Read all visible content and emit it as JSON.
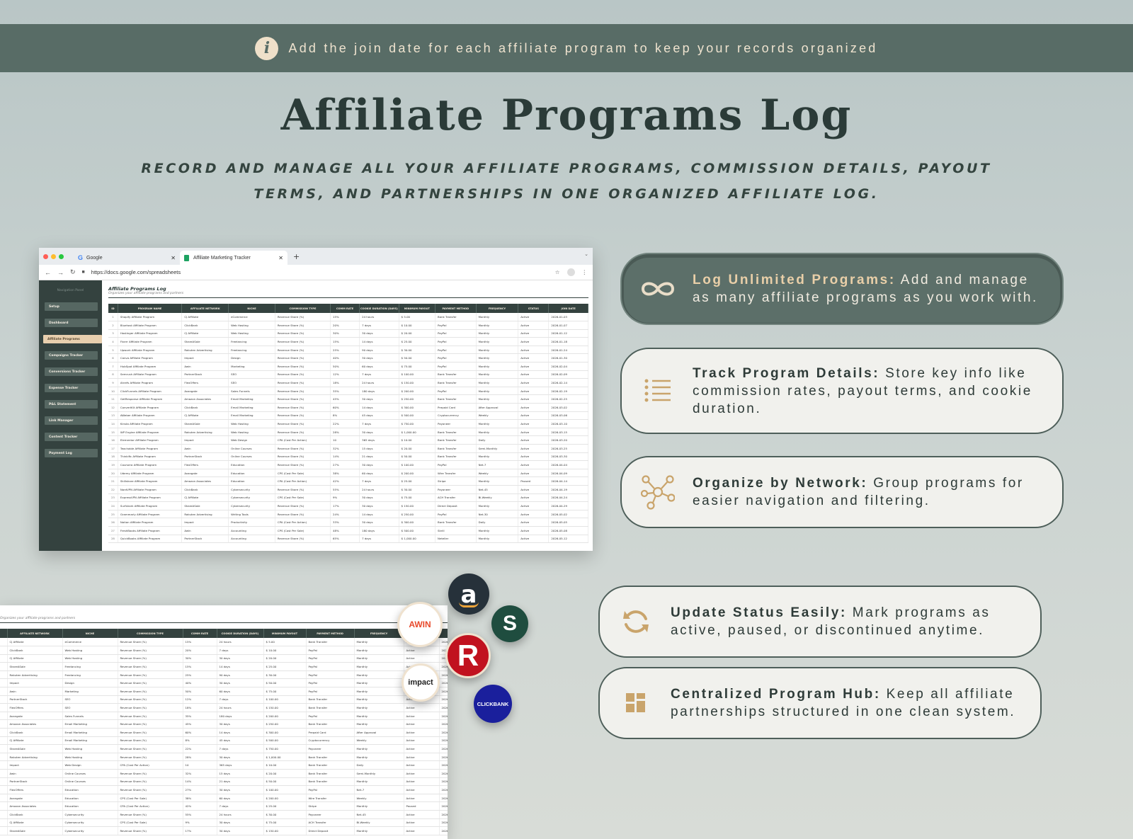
{
  "banner": {
    "icon": "info-icon",
    "text": "Add the join date for each affiliate program to keep your records organized"
  },
  "title": "Affiliate Programs Log",
  "subtitle": "RECORD AND MANAGE ALL YOUR AFFILIATE PROGRAMS, COMMISSION DETAILS, PAYOUT TERMS, AND PARTNERSHIPS IN ONE ORGANIZED AFFILIATE LOG.",
  "browser": {
    "tabs": [
      {
        "label": "Google",
        "icon": "google-icon"
      },
      {
        "label": "Affiliate Marketing Tracker",
        "icon": "sheets-icon"
      }
    ],
    "url": "https://docs.google.com/spreadsheets"
  },
  "sidebar": {
    "title": "Navigation Panel",
    "items": [
      {
        "label": "Setup"
      },
      {
        "label": "Dashboard"
      },
      {
        "label": "Affiliate Programs"
      },
      {
        "label": "Campaigns Tracker"
      },
      {
        "label": "Conversions Tracker"
      },
      {
        "label": "Expense Tracker"
      },
      {
        "label": "P&L Statement"
      },
      {
        "label": "Link Manager"
      },
      {
        "label": "Content Tracker"
      },
      {
        "label": "Payment Log"
      }
    ],
    "active": "Affiliate Programs"
  },
  "sheet": {
    "title": "Affiliate Programs Log",
    "subtitle": "Organizes your affiliate programs and partners",
    "columns": [
      "ID",
      "Program Name",
      "Affiliate Network",
      "Niche",
      "Commission Type",
      "Comm Rate",
      "Cookie Duration (Days)",
      "Minimum Payout",
      "Payment Method",
      "Frequency",
      "Status",
      "Join Date"
    ],
    "rows": [
      [
        "1",
        "Shopify Affiliate Program",
        "CJ Affiliate",
        "eCommerce",
        "Revenue Share (%)",
        "15%",
        "24 hours",
        "$ 5.00",
        "Bank Transfer",
        "Monthly",
        "Active",
        "2026-01-03"
      ],
      [
        "2",
        "Bluehost Affiliate Program",
        "ClickBank",
        "Web Hosting",
        "Revenue Share (%)",
        "20%",
        "7 days",
        "$ 10.00",
        "PayPal",
        "Monthly",
        "Active",
        "2026-01-07"
      ],
      [
        "3",
        "Hostinger Affiliate Program",
        "CJ Affiliate",
        "Web Hosting",
        "Revenue Share (%)",
        "30%",
        "30 days",
        "$ 20.00",
        "PayPal",
        "Monthly",
        "Active",
        "2026-01-12"
      ],
      [
        "4",
        "Fiverr Affiliate Program",
        "ShareASale",
        "Freelancing",
        "Revenue Share (%)",
        "15%",
        "14 days",
        "$ 25.00",
        "PayPal",
        "Monthly",
        "Active",
        "2026-01-18"
      ],
      [
        "5",
        "Upwork Affiliate Program",
        "Rakuten Advertising",
        "Freelancing",
        "Revenue Share (%)",
        "25%",
        "90 days",
        "$ 30.00",
        "PayPal",
        "Monthly",
        "Active",
        "2026-01-24"
      ],
      [
        "6",
        "Canva Affiliate Program",
        "Impact",
        "Design",
        "Revenue Share (%)",
        "40%",
        "30 days",
        "$ 50.00",
        "PayPal",
        "Monthly",
        "Active",
        "2026-01-30"
      ],
      [
        "7",
        "HubSpot Affiliate Program",
        "Awin",
        "Marketing",
        "Revenue Share (%)",
        "50%",
        "60 days",
        "$ 75.00",
        "PayPal",
        "Monthly",
        "Active",
        "2026-02-04"
      ],
      [
        "8",
        "Semrush Affiliate Program",
        "PartnerStack",
        "SEO",
        "Revenue Share (%)",
        "12%",
        "7 days",
        "$ 100.00",
        "Bank Transfer",
        "Monthly",
        "Active",
        "2026-02-09"
      ],
      [
        "9",
        "Ahrefs Affiliate Program",
        "FlexOffers",
        "SEO",
        "Revenue Share (%)",
        "18%",
        "24 hours",
        "$ 150.00",
        "Bank Transfer",
        "Monthly",
        "Active",
        "2026-02-14"
      ],
      [
        "10",
        "ClickFunnels Affiliate Program",
        "Avangate",
        "Sales Funnels",
        "Revenue Share (%)",
        "35%",
        "180 days",
        "$ 200.00",
        "PayPal",
        "Monthly",
        "Active",
        "2026-02-19"
      ],
      [
        "11",
        "GetResponse Affiliate Program",
        "Amazon Associates",
        "Email Marketing",
        "Revenue Share (%)",
        "45%",
        "30 days",
        "$ 250.00",
        "Bank Transfer",
        "Monthly",
        "Active",
        "2026-02-25"
      ],
      [
        "12",
        "ConvertKit Affiliate Program",
        "ClickBank",
        "Email Marketing",
        "Revenue Share (%)",
        "60%",
        "14 days",
        "$ 300.00",
        "Prepaid Card",
        "After Approval",
        "Active",
        "2026-03-02"
      ],
      [
        "13",
        "AWeber Affiliate Program",
        "CJ Affiliate",
        "Email Marketing",
        "Revenue Share (%)",
        "8%",
        "45 days",
        "$ 500.00",
        "Cryptocurrency",
        "Weekly",
        "Active",
        "2026-03-06"
      ],
      [
        "14",
        "Kinsta Affiliate Program",
        "ShareASale",
        "Web Hosting",
        "Revenue Share (%)",
        "22%",
        "7 days",
        "$ 750.00",
        "Payoneer",
        "Monthly",
        "Active",
        "2026-03-10"
      ],
      [
        "15",
        "WP Engine Affiliate Program",
        "Rakuten Advertising",
        "Web Hosting",
        "Revenue Share (%)",
        "28%",
        "30 days",
        "$ 1,000.00",
        "Bank Transfer",
        "Monthly",
        "Active",
        "2026-03-15"
      ],
      [
        "16",
        "Elementor Affiliate Program",
        "Impact",
        "Web Design",
        "CPA (Cost Per Action)",
        "10",
        "365 days",
        "$ 10.00",
        "Bank Transfer",
        "Daily",
        "Active",
        "2026-03-20"
      ],
      [
        "17",
        "Teachable Affiliate Program",
        "Awin",
        "Online Courses",
        "Revenue Share (%)",
        "32%",
        "15 days",
        "$ 20.00",
        "Bank Transfer",
        "Semi-Monthly",
        "Active",
        "2026-03-25"
      ],
      [
        "18",
        "Thinkific Affiliate Program",
        "PartnerStack",
        "Online Courses",
        "Revenue Share (%)",
        "14%",
        "21 days",
        "$ 50.00",
        "Bank Transfer",
        "Monthly",
        "Active",
        "2026-03-30"
      ],
      [
        "19",
        "Coursera Affiliate Program",
        "FlexOffers",
        "Education",
        "Revenue Share (%)",
        "27%",
        "30 days",
        "$ 100.00",
        "PayPal",
        "Net-7",
        "Active",
        "2026-04-04"
      ],
      [
        "20",
        "Udemy Affiliate Program",
        "Avangate",
        "Education",
        "CPS (Cost Per Sale)",
        "38%",
        "60 days",
        "$ 200.00",
        "Wire Transfer",
        "Weekly",
        "Active",
        "2026-04-09"
      ],
      [
        "21",
        "Skillshare Affiliate Program",
        "Amazon Associates",
        "Education",
        "CPA (Cost Per Action)",
        "42%",
        "7 days",
        "$ 25.00",
        "Stripe",
        "Monthly",
        "Paused",
        "2026-04-14"
      ],
      [
        "22",
        "NordVPN Affiliate Program",
        "ClickBank",
        "Cybersecurity",
        "Revenue Share (%)",
        "55%",
        "24 hours",
        "$ 30.00",
        "Payoneer",
        "Net-45",
        "Active",
        "2026-04-19"
      ],
      [
        "23",
        "ExpressVPN Affiliate Program",
        "CJ Affiliate",
        "Cybersecurity",
        "CPS (Cost Per Sale)",
        "9%",
        "30 days",
        "$ 75.00",
        "ACH Transfer",
        "Bi-Weekly",
        "Active",
        "2026-04-24"
      ],
      [
        "24",
        "Surfshark Affiliate Program",
        "ShareASale",
        "Cybersecurity",
        "Revenue Share (%)",
        "17%",
        "30 days",
        "$ 150.00",
        "Direct Deposit",
        "Monthly",
        "Active",
        "2026-04-29"
      ],
      [
        "25",
        "Grammarly Affiliate Program",
        "Rakuten Advertising",
        "Writing Tools",
        "Revenue Share (%)",
        "24%",
        "14 days",
        "$ 250.00",
        "PayPal",
        "Net-30",
        "Active",
        "2026-05-02"
      ],
      [
        "26",
        "Notion Affiliate Program",
        "Impact",
        "Productivity",
        "CPA (Cost Per Action)",
        "33%",
        "30 days",
        "$ 300.00",
        "Bank Transfer",
        "Daily",
        "Active",
        "2026-05-05"
      ],
      [
        "27",
        "FreshBooks Affiliate Program",
        "Awin",
        "Accounting",
        "CPS (Cost Per Sale)",
        "48%",
        "180 days",
        "$ 500.00",
        "Skrill",
        "Monthly",
        "Active",
        "2026-05-08"
      ],
      [
        "28",
        "QuickBooks Affiliate Program",
        "PartnerStack",
        "Accounting",
        "Revenue Share (%)",
        "65%",
        "7 days",
        "$ 1,000.00",
        "Neteller",
        "Monthly",
        "Active",
        "2026-05-12"
      ]
    ]
  },
  "logos": [
    {
      "name": "amazon",
      "text": "a"
    },
    {
      "name": "awin",
      "text": "AWIN"
    },
    {
      "name": "skimlinks",
      "text": "S"
    },
    {
      "name": "rakuten",
      "text": "R"
    },
    {
      "name": "impact",
      "text": "impact"
    },
    {
      "name": "clickbank",
      "text": "CLICKBANK"
    }
  ],
  "features": [
    {
      "title": "Log Unlimited Programs:",
      "body": "Add and manage as many affiliate programs as you work with.",
      "icon": "infinity-icon"
    },
    {
      "title": "Track Program Details:",
      "body": "Store key info like commission rates, payout terms, and cookie duration.",
      "icon": "list-icon"
    },
    {
      "title": "Organize by Network:",
      "body": "Group programs for easier navigation and filtering.",
      "icon": "network-icon"
    },
    {
      "title": "Update Status Easily:",
      "body": "Mark programs as active, paused, or discontinued anytime.",
      "icon": "refresh-icon"
    },
    {
      "title": "Centralized Program Hub:",
      "body": "Keep all affiliate partnerships structured in one clean system.",
      "icon": "grid-icon"
    }
  ],
  "colors": {
    "accent_dark": "#586c66",
    "accent_gold": "#c9a46b",
    "sidebar": "#34423f"
  }
}
